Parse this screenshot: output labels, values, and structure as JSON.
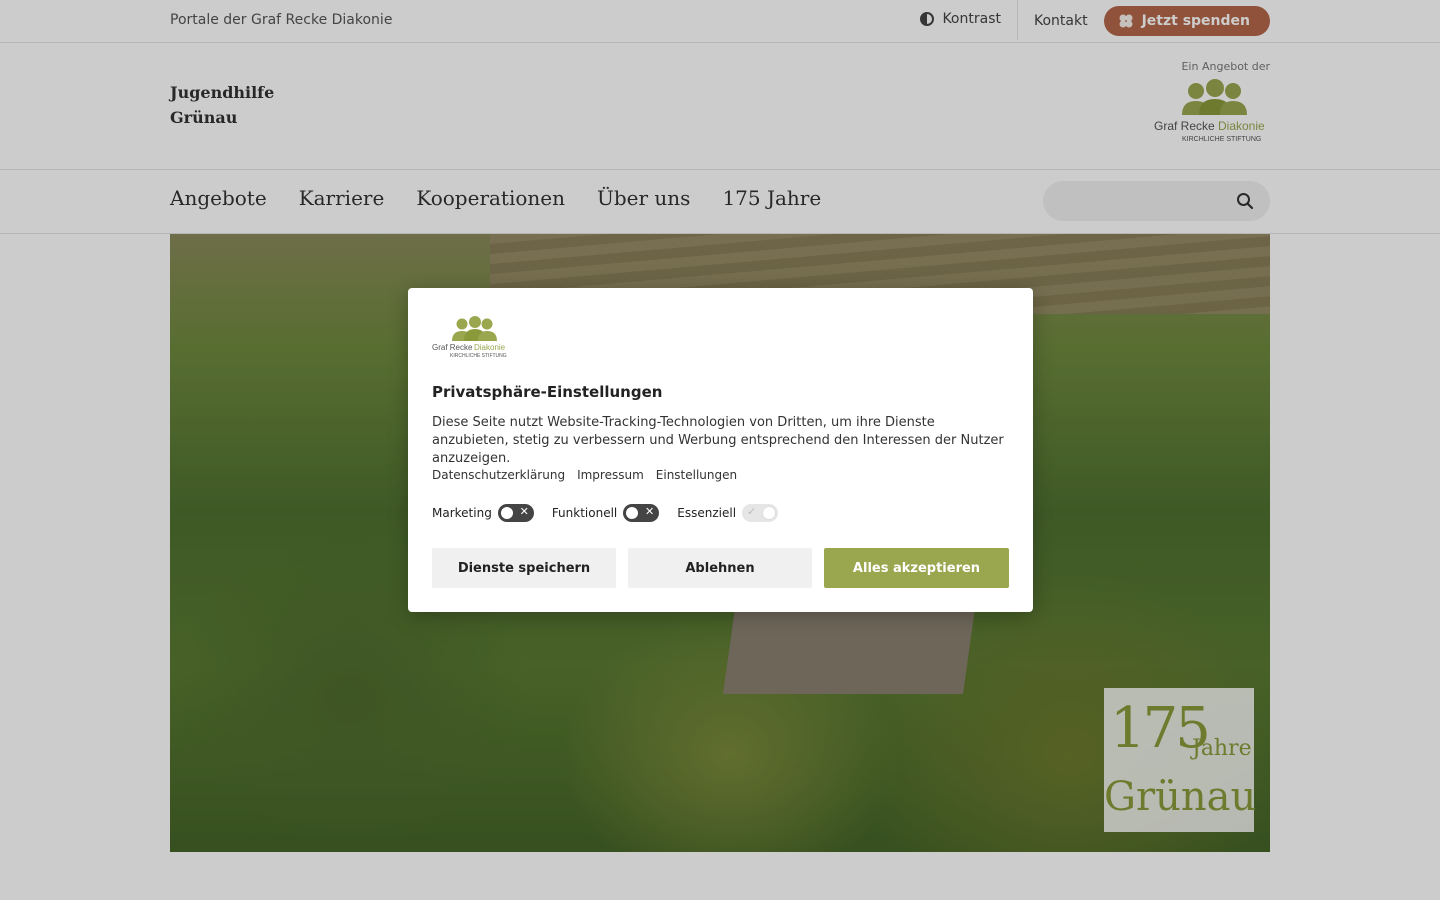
{
  "topbar": {
    "portal_label": "Portale der Graf Recke Diakonie",
    "contrast_label": "Kontrast",
    "contact_label": "Kontakt",
    "donate_label": "Jetzt spenden"
  },
  "header": {
    "title_line1": "Jugendhilfe",
    "title_line2": "Grünau",
    "brand_tagline": "Ein Angebot der",
    "brand_name_1": "Graf Recke",
    "brand_name_2": "Diakonie",
    "brand_sub": "KIRCHLICHE STIFTUNG"
  },
  "nav": {
    "items": [
      "Angebote",
      "Karriere",
      "Kooperationen",
      "Über uns",
      "175 Jahre"
    ],
    "search_placeholder": ""
  },
  "hero": {
    "badge_number": "175",
    "badge_word": "Jahre",
    "badge_place": "Grünau"
  },
  "modal": {
    "logo_name_1": "Graf Recke",
    "logo_name_2": "Diakonie",
    "logo_sub": "KIRCHLICHE STIFTUNG",
    "title": "Privatsphäre-Einstellungen",
    "text": "Diese Seite nutzt Website-Tracking-Technologien von Dritten, um ihre Dienste anzubieten, stetig zu verbessern und Werbung entsprechend den Interessen der Nutzer anzuzeigen.",
    "links": [
      "Datenschutzerklärung",
      "Impressum",
      "Einstellungen"
    ],
    "toggles": [
      {
        "label": "Marketing",
        "on": false
      },
      {
        "label": "Funktionell",
        "on": false
      },
      {
        "label": "Essenziell",
        "on": true
      }
    ],
    "save_label": "Dienste speichern",
    "decline_label": "Ablehnen",
    "accept_label": "Alles akzeptieren"
  },
  "colors": {
    "brand_green": "#9aa74f",
    "donate": "#b5674a"
  }
}
